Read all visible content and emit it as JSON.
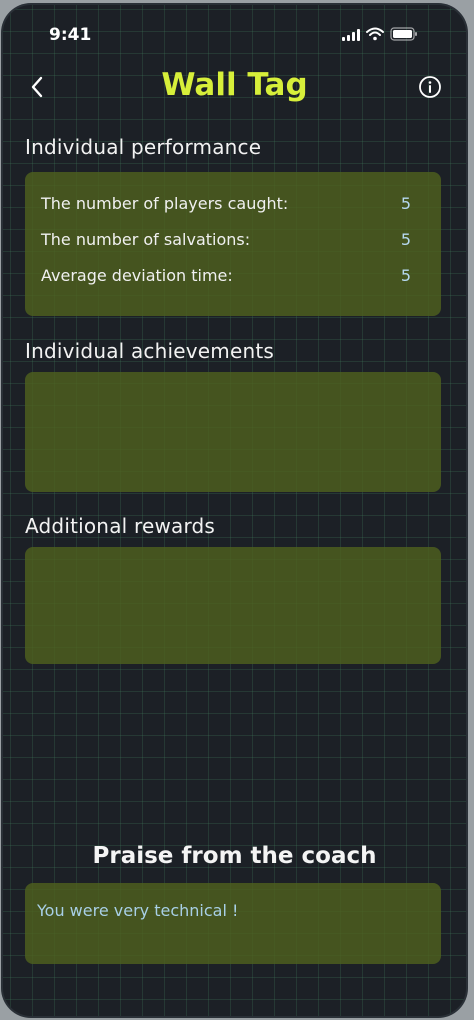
{
  "status_bar": {
    "time": "9:41",
    "icons": [
      "signal-icon",
      "wifi-icon",
      "battery-icon"
    ]
  },
  "header": {
    "title": "Wall Tag",
    "back_icon": "chevron-left-icon",
    "info_icon": "info-circle-icon"
  },
  "performance": {
    "title": "Individual performance",
    "rows": [
      {
        "label": "The number of players caught:",
        "value": "5"
      },
      {
        "label": "The number of salvations:",
        "value": "5"
      },
      {
        "label": "Average deviation time:",
        "value": "5"
      }
    ]
  },
  "achievements": {
    "title": "Individual achievements"
  },
  "rewards": {
    "title": "Additional rewards"
  },
  "praise": {
    "title": "Praise from the coach",
    "text": "You were very technical !"
  },
  "colors": {
    "title_accent": "#d7ef3a",
    "card_bg": "#4e601e",
    "value_text": "#b6d8f0",
    "background": "#1c2026"
  }
}
